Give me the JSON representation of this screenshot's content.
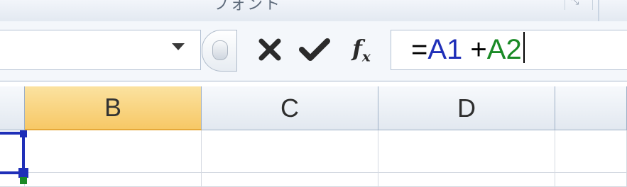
{
  "ribbon": {
    "group_label": "フォント",
    "launcher_glyph": "⤡"
  },
  "formula_bar": {
    "name_box_value": "",
    "formula_tokens": [
      "=",
      "A1",
      " +",
      "A2"
    ],
    "fx_label": "f",
    "fx_sub": "x"
  },
  "columns": [
    "B",
    "C",
    "D"
  ],
  "selected_column": "B",
  "colors": {
    "ref_a1": "#1f2fb8",
    "ref_a2": "#1a8a26",
    "selected_header": "#f7c866"
  }
}
